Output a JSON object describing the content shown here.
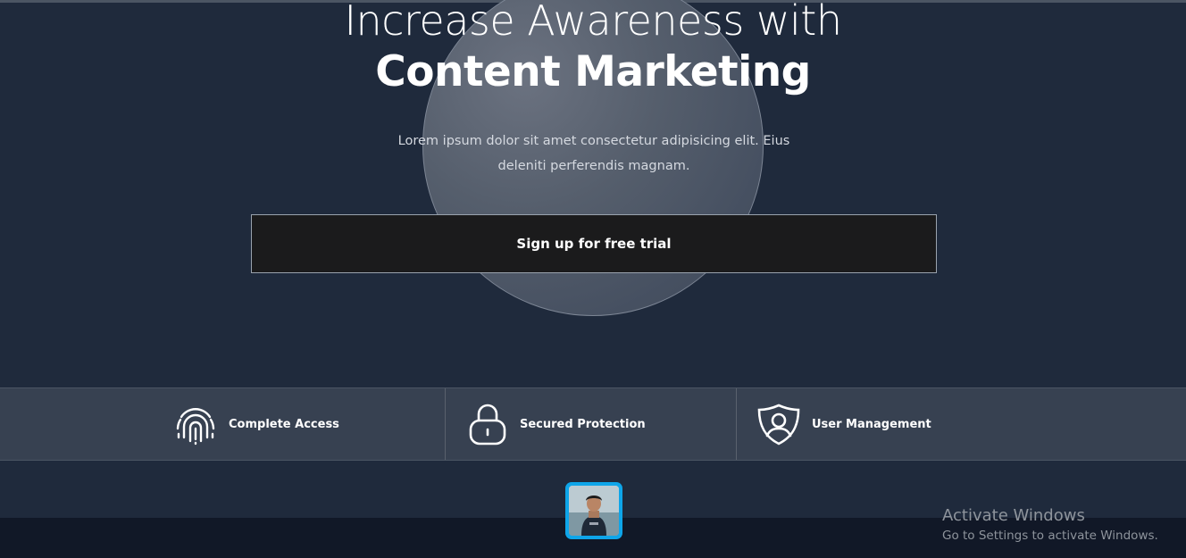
{
  "hero": {
    "title_light": "Increase Awareness with",
    "title_bold": "Content Marketing",
    "description": "Lorem ipsum dolor sit amet consectetur adipisicing elit. Eius deleniti perferendis magnam.",
    "cta_label": "Sign up for free trial"
  },
  "features": [
    {
      "label": "Complete Access",
      "icon": "fingerprint-icon"
    },
    {
      "label": "Secured Protection",
      "icon": "lock-icon"
    },
    {
      "label": "User Management",
      "icon": "user-shield-icon"
    }
  ],
  "avatar": {
    "icon": "avatar"
  },
  "watermark": {
    "title": "Activate Windows",
    "subtitle": "Go to Settings to activate Windows."
  },
  "colors": {
    "background": "#1f2a3c",
    "feature_bar": "#374151",
    "button": "#1b1b1c",
    "avatar_border": "#0ea5e9",
    "bottom_band": "#111827"
  }
}
